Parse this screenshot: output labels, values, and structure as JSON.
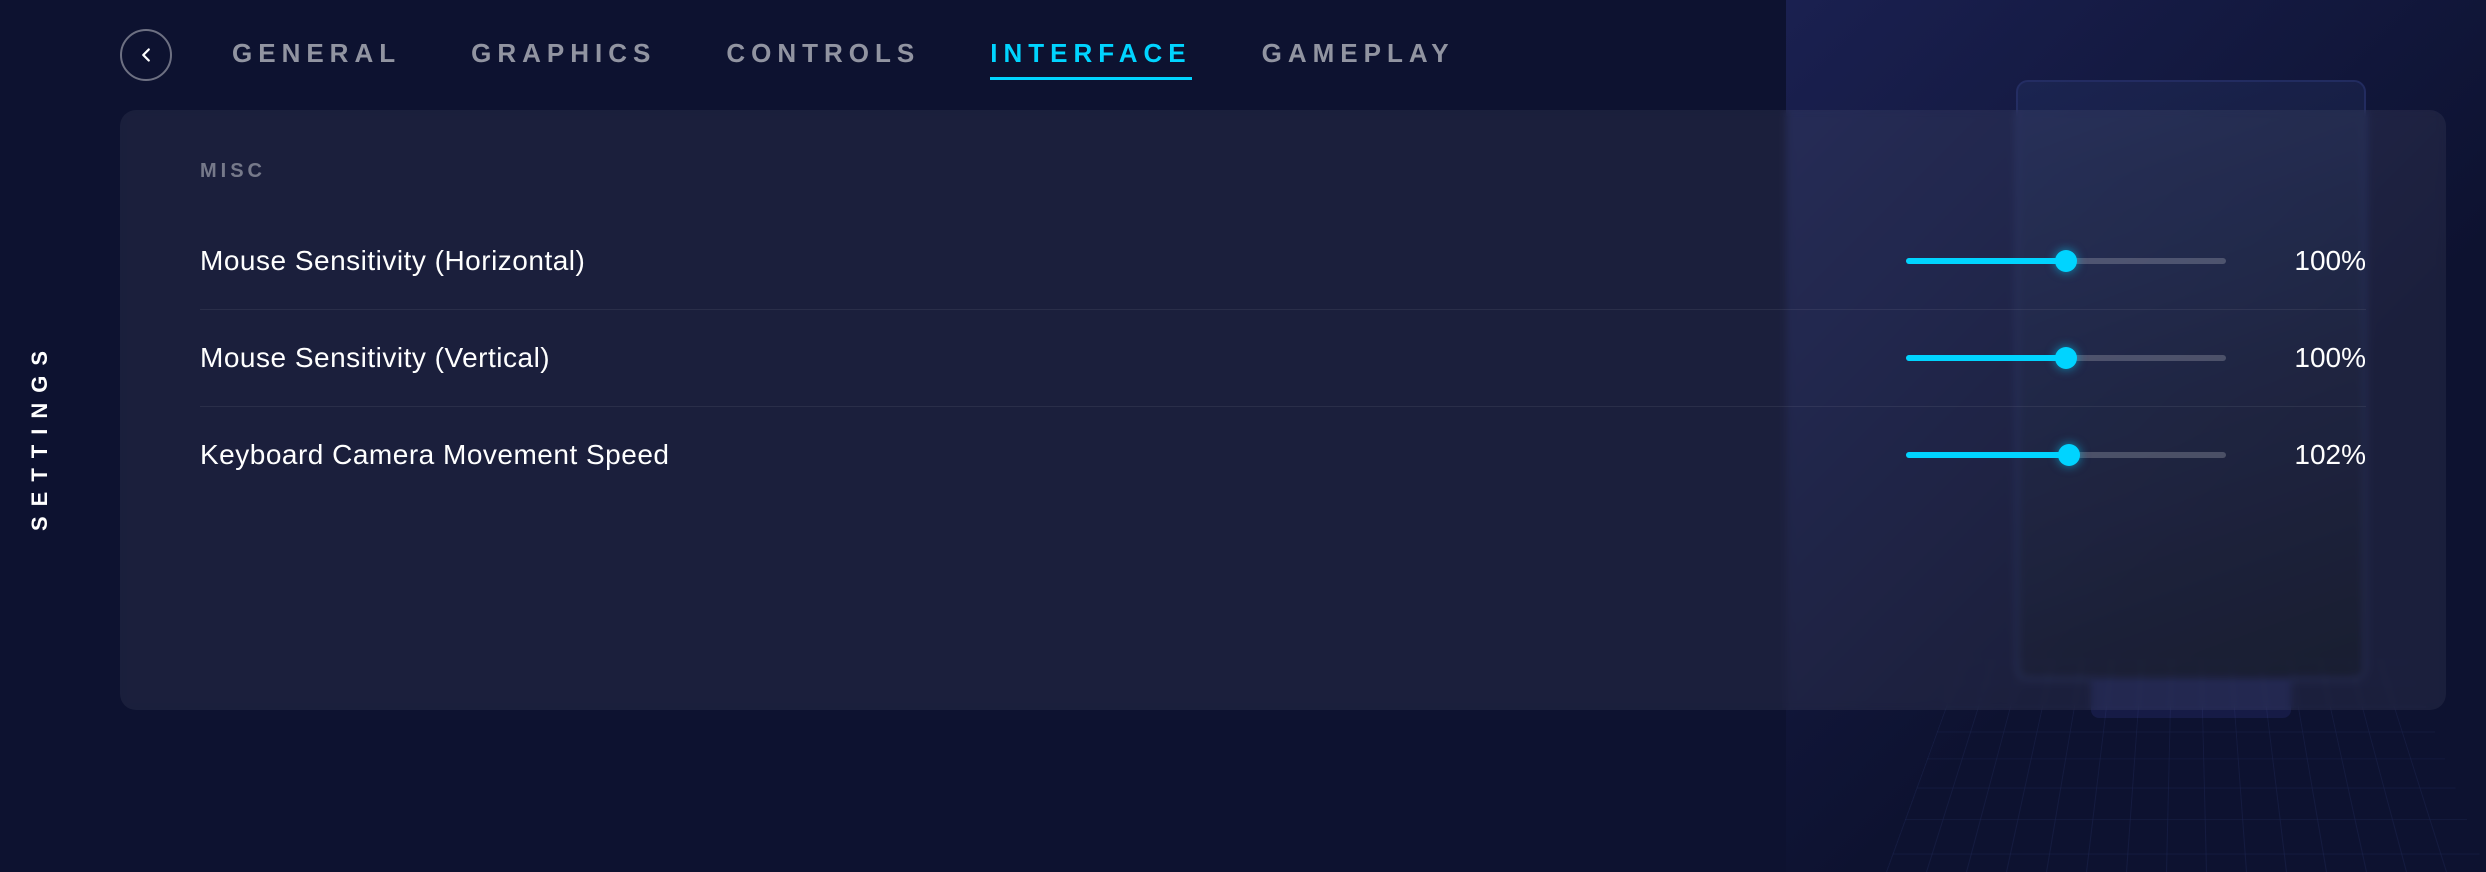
{
  "sidebar": {
    "settings_label": "SETTINGS"
  },
  "nav": {
    "back_button_label": "←",
    "tabs": [
      {
        "id": "general",
        "label": "GENERAL",
        "active": false
      },
      {
        "id": "graphics",
        "label": "GRAPHICS",
        "active": false
      },
      {
        "id": "controls",
        "label": "CONTROLS",
        "active": false
      },
      {
        "id": "interface",
        "label": "INTERFACE",
        "active": true
      },
      {
        "id": "gameplay",
        "label": "GAMEPLAY",
        "active": false
      }
    ]
  },
  "panel": {
    "section_title": "MISC",
    "settings": [
      {
        "id": "mouse-h",
        "label": "Mouse Sensitivity (Horizontal)",
        "value": 100,
        "display_value": "100%",
        "min": 0,
        "max": 200,
        "fill_percent": 50
      },
      {
        "id": "mouse-v",
        "label": "Mouse Sensitivity (Vertical)",
        "value": 100,
        "display_value": "100%",
        "min": 0,
        "max": 200,
        "fill_percent": 50
      },
      {
        "id": "keyboard-cam",
        "label": "Keyboard Camera Movement Speed",
        "value": 102,
        "display_value": "102%",
        "min": 0,
        "max": 200,
        "fill_percent": 51
      }
    ]
  },
  "colors": {
    "accent": "#00d4ff",
    "background": "#0d1230",
    "panel_bg": "rgba(255,255,255,0.06)"
  }
}
